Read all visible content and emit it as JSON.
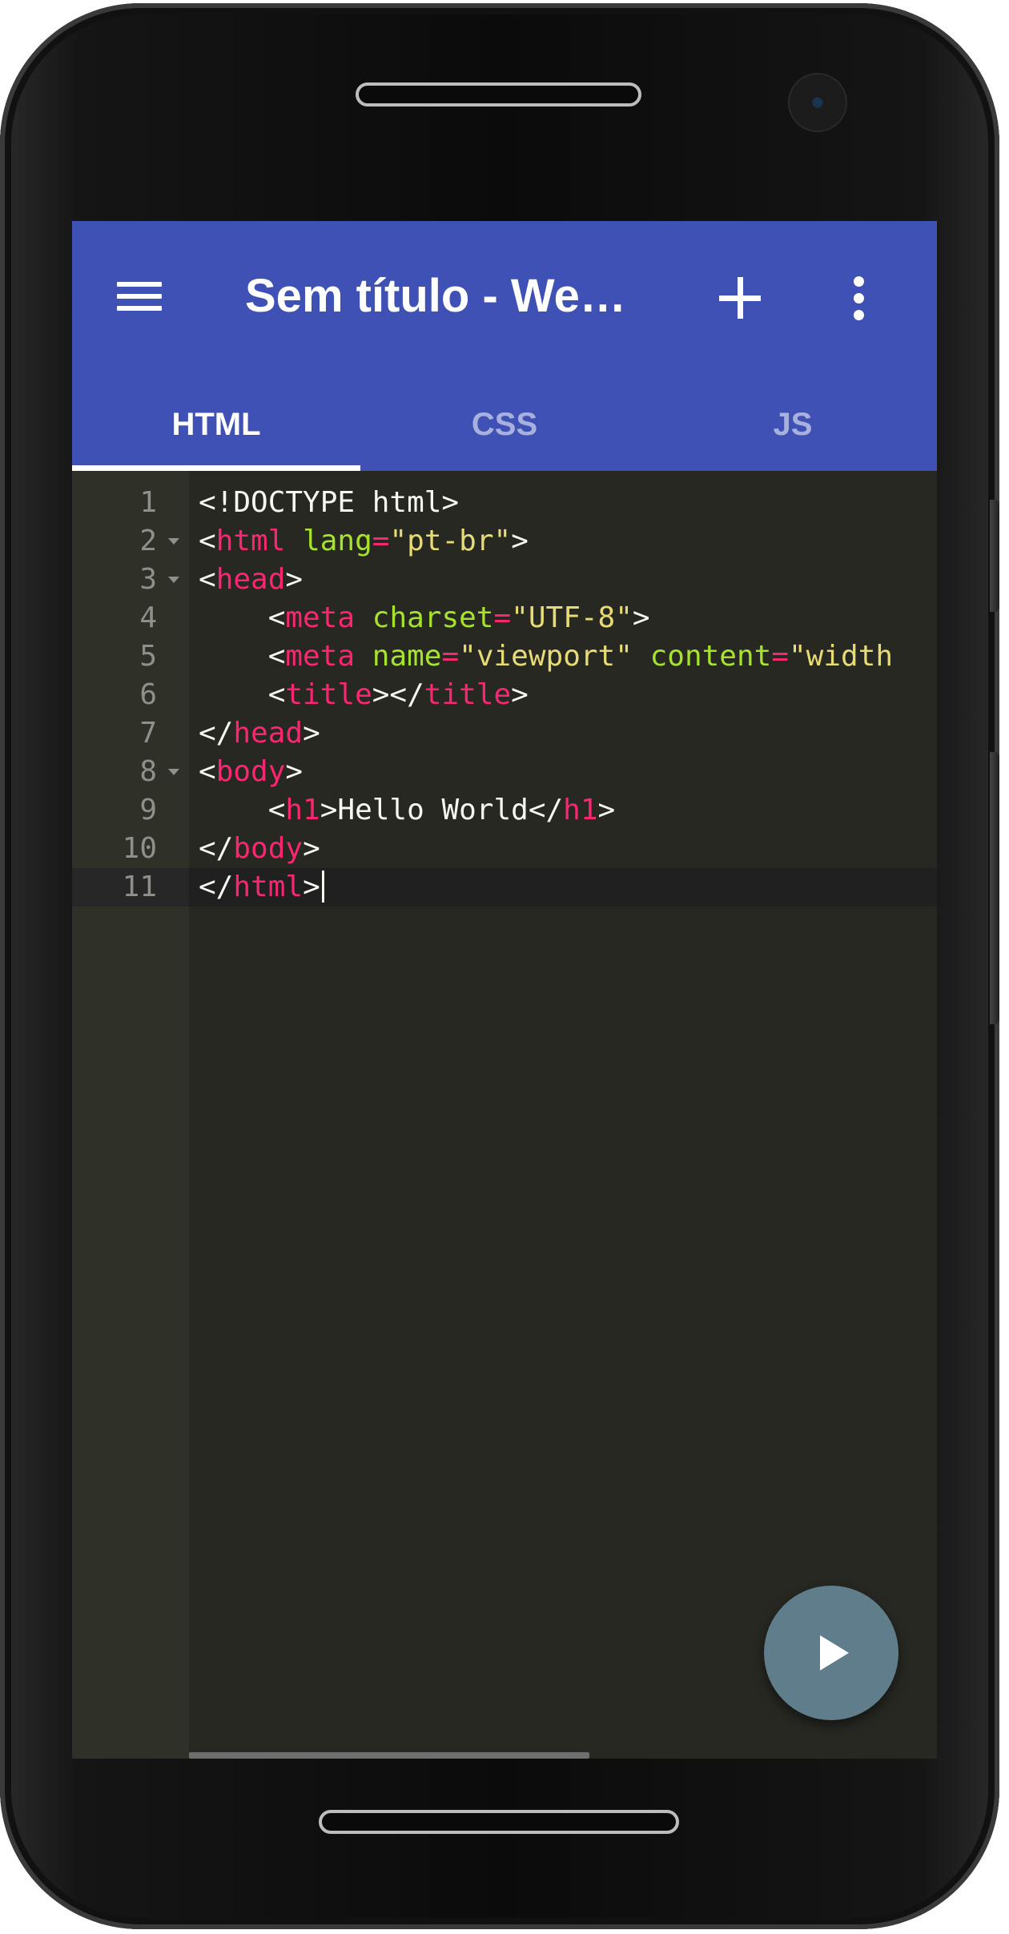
{
  "appbar": {
    "title": "Sem título - We…",
    "menu_icon": "hamburger-menu-icon",
    "add_icon": "plus-icon",
    "more_icon": "more-vert-icon",
    "color": "#3f51b5"
  },
  "tabs": [
    {
      "label": "HTML",
      "active": true
    },
    {
      "label": "CSS",
      "active": false
    },
    {
      "label": "JS",
      "active": false
    }
  ],
  "editor": {
    "theme_bg": "#272822",
    "lines": [
      {
        "n": "1",
        "fold": false,
        "tokens": [
          {
            "t": "plain",
            "v": "<!DOCTYPE html>"
          }
        ]
      },
      {
        "n": "2",
        "fold": true,
        "tokens": [
          {
            "t": "plain",
            "v": "<"
          },
          {
            "t": "tag",
            "v": "html"
          },
          {
            "t": "plain",
            "v": " "
          },
          {
            "t": "attr",
            "v": "lang"
          },
          {
            "t": "tag",
            "v": "="
          },
          {
            "t": "str",
            "v": "\"pt-br\""
          },
          {
            "t": "plain",
            "v": ">"
          }
        ]
      },
      {
        "n": "3",
        "fold": true,
        "tokens": [
          {
            "t": "plain",
            "v": "<"
          },
          {
            "t": "tag",
            "v": "head"
          },
          {
            "t": "plain",
            "v": ">"
          }
        ]
      },
      {
        "n": "4",
        "fold": false,
        "tokens": [
          {
            "t": "plain",
            "v": "    <"
          },
          {
            "t": "tag",
            "v": "meta"
          },
          {
            "t": "plain",
            "v": " "
          },
          {
            "t": "attr",
            "v": "charset"
          },
          {
            "t": "tag",
            "v": "="
          },
          {
            "t": "str",
            "v": "\"UTF-8\""
          },
          {
            "t": "plain",
            "v": ">"
          }
        ]
      },
      {
        "n": "5",
        "fold": false,
        "tokens": [
          {
            "t": "plain",
            "v": "    <"
          },
          {
            "t": "tag",
            "v": "meta"
          },
          {
            "t": "plain",
            "v": " "
          },
          {
            "t": "attr",
            "v": "name"
          },
          {
            "t": "tag",
            "v": "="
          },
          {
            "t": "str",
            "v": "\"viewport\""
          },
          {
            "t": "plain",
            "v": " "
          },
          {
            "t": "attr",
            "v": "content"
          },
          {
            "t": "tag",
            "v": "="
          },
          {
            "t": "str",
            "v": "\"width"
          }
        ]
      },
      {
        "n": "6",
        "fold": false,
        "tokens": [
          {
            "t": "plain",
            "v": "    <"
          },
          {
            "t": "tag",
            "v": "title"
          },
          {
            "t": "plain",
            "v": "></"
          },
          {
            "t": "tag",
            "v": "title"
          },
          {
            "t": "plain",
            "v": ">"
          }
        ]
      },
      {
        "n": "7",
        "fold": false,
        "tokens": [
          {
            "t": "plain",
            "v": "</"
          },
          {
            "t": "tag",
            "v": "head"
          },
          {
            "t": "plain",
            "v": ">"
          }
        ]
      },
      {
        "n": "8",
        "fold": true,
        "tokens": [
          {
            "t": "plain",
            "v": "<"
          },
          {
            "t": "tag",
            "v": "body"
          },
          {
            "t": "plain",
            "v": ">"
          }
        ]
      },
      {
        "n": "9",
        "fold": false,
        "tokens": [
          {
            "t": "plain",
            "v": "    <"
          },
          {
            "t": "tag",
            "v": "h1"
          },
          {
            "t": "plain",
            "v": ">Hello World</"
          },
          {
            "t": "tag",
            "v": "h1"
          },
          {
            "t": "plain",
            "v": ">"
          }
        ]
      },
      {
        "n": "10",
        "fold": false,
        "tokens": [
          {
            "t": "plain",
            "v": "</"
          },
          {
            "t": "tag",
            "v": "body"
          },
          {
            "t": "plain",
            "v": ">"
          }
        ]
      },
      {
        "n": "11",
        "fold": false,
        "current": true,
        "tokens": [
          {
            "t": "plain",
            "v": "</"
          },
          {
            "t": "tag",
            "v": "html"
          },
          {
            "t": "plain",
            "v": ">"
          }
        ]
      }
    ]
  },
  "fab": {
    "icon": "play-icon",
    "color": "#607d8b"
  }
}
